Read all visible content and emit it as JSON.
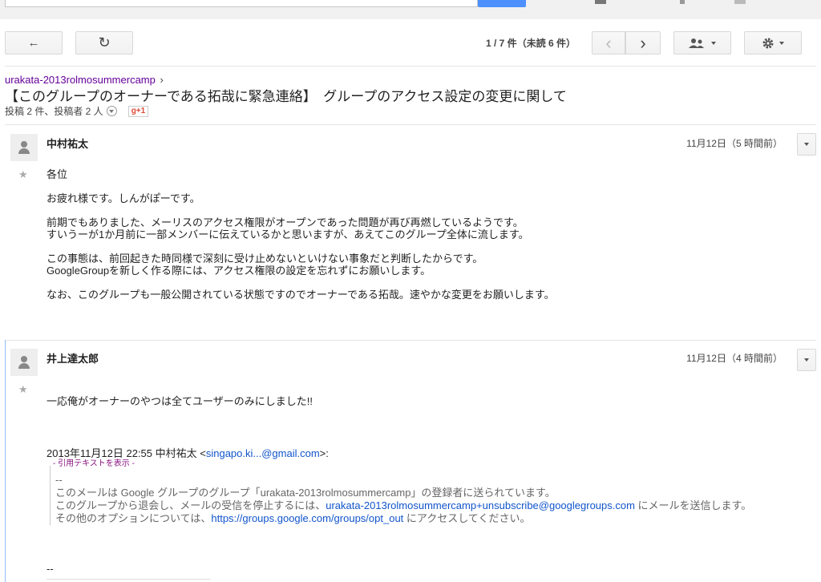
{
  "toolbar": {
    "back_icon": "←",
    "refresh_icon": "↻",
    "prev_icon": "‹",
    "next_icon": "›",
    "people_icon": "people-icon",
    "settings_icon": "gear-icon"
  },
  "pagination": {
    "range": "1 / 7 件",
    "unread": "（未読 6 件）"
  },
  "breadcrumb": {
    "group": "urakata-2013rolmosummercamp",
    "sep": "›"
  },
  "thread": {
    "title": "【このグループのオーナーである拓哉に緊急連絡】　グループのアクセス設定の変更に関して",
    "stats": "投稿 2 件、投稿者 2 人",
    "gplus": "g+1"
  },
  "messages": [
    {
      "author": "中村祐太",
      "date": "11月12日（5 時間前）",
      "paragraphs": [
        "各位",
        "お疲れ様です。しんがぽーです。",
        "前期でもありました、メーリスのアクセス権限がオープンであった問題が再び再燃しているようです。",
        "すいうーが1か月前に一部メンバーに伝えているかと思いますが、あえてこのグループ全体に流します。",
        "この事態は、前回起きた時同様で深刻に受け止めないといけない事象だと判断したからです。",
        "GoogleGroupを新しく作る際には、アクセス権限の設定を忘れずにお願いします。",
        "なお、このグループも一般公開されている状態ですのでオーナーである拓哉。速やかな変更をお願いします。"
      ]
    },
    {
      "author": "井上達太郎",
      "date": "11月12日（4 時間前）",
      "body": "一応俺がオーナーのやつは全てユーザーのみにしました!!",
      "quote_header_prefix": "2013年11月12日 22:55 中村祐太 <",
      "quote_header_email": "singapo.ki...@gmail.com",
      "quote_header_suffix": ">:",
      "show_quote": "- 引用テキストを表示 -",
      "quote_dash": "--",
      "quote_line1": "このメールは Google グループのグループ「urakata-2013rolmosummercamp」の登録者に送られています。",
      "quote_line2_prefix": "このグループから退会し、メールの受信を停止するには、",
      "quote_line2_link": "urakata-2013rolmosummercamp+unsubscribe@googlegroups.com",
      "quote_line2_suffix": " にメールを送信します。",
      "quote_line3_prefix": "その他のオプションについては、",
      "quote_line3_link": "https://groups.google.com/groups/opt_out",
      "quote_line3_suffix": " にアクセスしてください。",
      "sig_dash": "--"
    }
  ],
  "star_icon": "★",
  "colors": {
    "accent": "#4d90fe",
    "link": "#1155cc",
    "visited": "#660099"
  }
}
